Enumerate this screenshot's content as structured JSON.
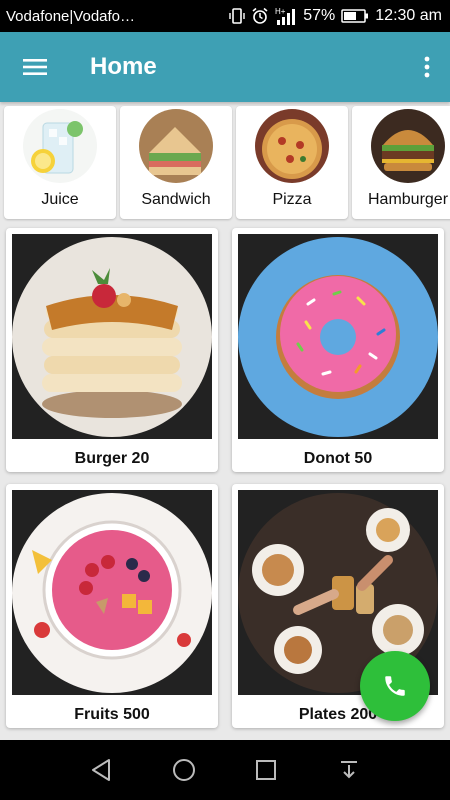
{
  "status_bar": {
    "carrier": "Vodafone|Vodafo…",
    "network": "H+",
    "battery": "57%",
    "time": "12:30 am"
  },
  "app_bar": {
    "title": "Home"
  },
  "categories": [
    {
      "label": "Juice"
    },
    {
      "label": "Sandwich"
    },
    {
      "label": "Pizza"
    },
    {
      "label": "Hamburger"
    }
  ],
  "products": [
    {
      "caption": "Burger  20",
      "image": "pancake-stack"
    },
    {
      "caption": "Donot 50",
      "image": "pink-donut"
    },
    {
      "caption": "Fruits 500",
      "image": "fruit-bowl"
    },
    {
      "caption": "Plates 200",
      "image": "dinner-plates"
    }
  ],
  "fab": {
    "icon": "phone-icon",
    "color": "#2ebf3a"
  },
  "colors": {
    "app_bar": "#3ea0b4",
    "background": "#e9e9e9"
  }
}
